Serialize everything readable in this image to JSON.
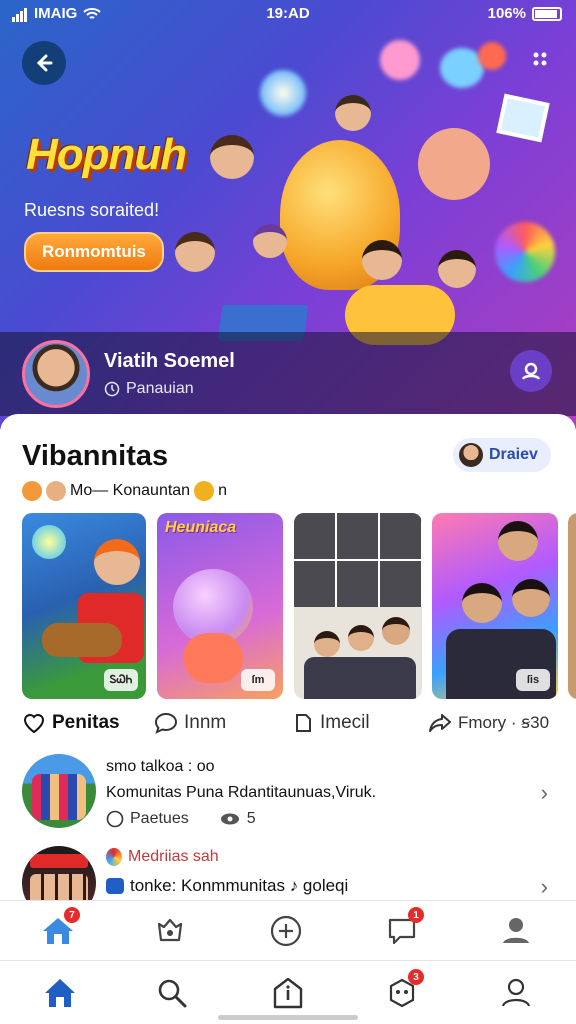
{
  "status_bar": {
    "carrier": "IMAIG",
    "time": "19:AD",
    "battery": "106%"
  },
  "hero": {
    "title": "Hopnuh",
    "subtitle": "Ruesns soraited!",
    "cta_label": "Ronmomtuis",
    "user_name": "Viatih Soemel",
    "user_role": "Panauian"
  },
  "community": {
    "title": "Vibannitas",
    "follow_label": "Draiev",
    "tagline": "Mo— Konauntan",
    "cards": [
      {
        "badge": "ᏚᏇᏂ"
      },
      {
        "label": "Heuniaca",
        "badge": "ſm"
      },
      {
        "badge": ""
      },
      {
        "badge": "ſis"
      }
    ],
    "actions": [
      {
        "label": "Penitas",
        "icon": "heart-icon"
      },
      {
        "label": "Innm",
        "icon": "comment-icon"
      },
      {
        "label": "Imecil",
        "icon": "save-icon"
      },
      {
        "label": "Fmory · ꞩ30",
        "icon": "share-icon"
      }
    ]
  },
  "feed": [
    {
      "title": "smo talkoa : oo",
      "body": "Komunitas Puna Rdantitaunuas,Viruk.",
      "meta_label": "Paetues",
      "meta_count": "5"
    },
    {
      "title": "Medriias sah",
      "body": "tonke: Konmmunitas ♪ goleqi"
    }
  ],
  "tab_bar_top": [
    {
      "icon": "home-icon",
      "badge": "7"
    },
    {
      "icon": "community-icon",
      "badge": ""
    },
    {
      "icon": "add-icon",
      "badge": ""
    },
    {
      "icon": "chat-icon",
      "badge": "1"
    },
    {
      "icon": "profile-icon",
      "badge": ""
    }
  ],
  "tab_bar_bottom": [
    {
      "icon": "home-icon",
      "badge": ""
    },
    {
      "icon": "search-icon",
      "badge": ""
    },
    {
      "icon": "upload-icon",
      "badge": ""
    },
    {
      "icon": "game-icon",
      "badge": "3"
    },
    {
      "icon": "profile-icon",
      "badge": ""
    }
  ],
  "colors": {
    "accent": "#1f5fc4",
    "badge": "#e62b2b",
    "hero_title": "#ffe03a"
  }
}
